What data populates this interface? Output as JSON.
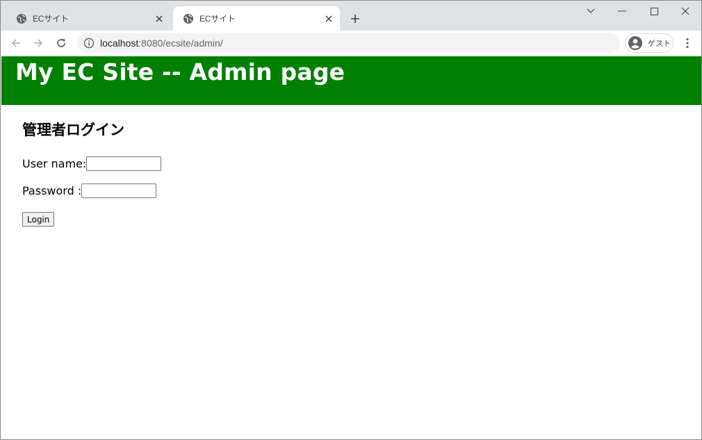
{
  "browser": {
    "tabs": [
      {
        "title": "ECサイト",
        "active": false
      },
      {
        "title": "ECサイト",
        "active": true
      }
    ],
    "new_tab_icon": "plus-icon",
    "window_controls": [
      "chevron-down-icon",
      "minimize-icon",
      "maximize-icon",
      "close-icon"
    ],
    "url_host": "localhost",
    "url_rest": ":8080/ecsite/admin/",
    "profile_label": "ゲスト"
  },
  "page": {
    "header_title": "My EC Site -- Admin page",
    "header_color": "#008000",
    "login_heading": "管理者ログイン",
    "username_label": "User name:",
    "username_value": "",
    "password_label": "Password :",
    "password_value": "",
    "login_button": "Login"
  }
}
